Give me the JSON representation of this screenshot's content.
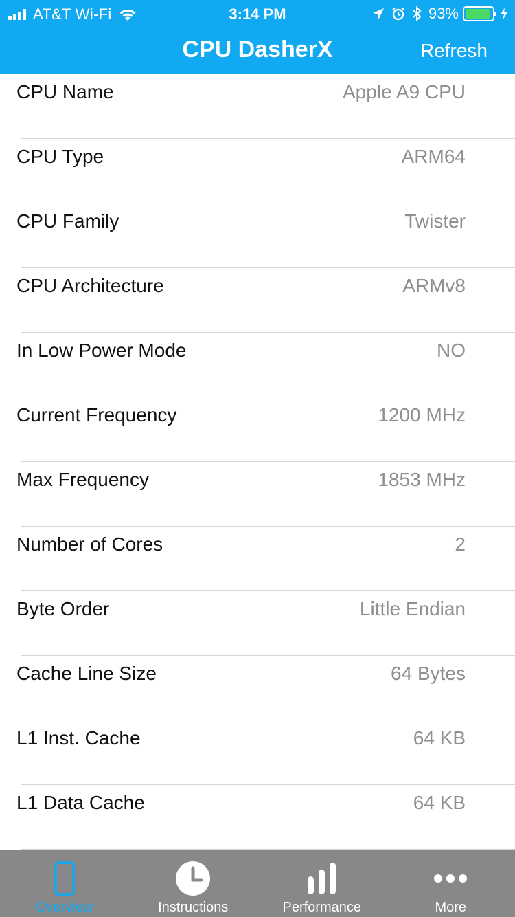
{
  "status_bar": {
    "carrier": "AT&T Wi-Fi",
    "time": "3:14 PM",
    "battery_percent": "93%",
    "battery_level": 0.93
  },
  "nav": {
    "title": "CPU DasherX",
    "refresh_label": "Refresh"
  },
  "rows": [
    {
      "label": "CPU Name",
      "value": "Apple A9 CPU"
    },
    {
      "label": "CPU Type",
      "value": "ARM64"
    },
    {
      "label": "CPU Family",
      "value": "Twister"
    },
    {
      "label": "CPU Architecture",
      "value": "ARMv8"
    },
    {
      "label": "In Low Power Mode",
      "value": "NO"
    },
    {
      "label": "Current Frequency",
      "value": "1200 MHz"
    },
    {
      "label": "Max Frequency",
      "value": "1853 MHz"
    },
    {
      "label": "Number of Cores",
      "value": "2"
    },
    {
      "label": "Byte Order",
      "value": "Little Endian"
    },
    {
      "label": "Cache Line Size",
      "value": "64 Bytes"
    },
    {
      "label": "L1 Inst. Cache",
      "value": "64 KB"
    },
    {
      "label": "L1 Data Cache",
      "value": "64 KB"
    }
  ],
  "tabs": [
    {
      "label": "Overview",
      "icon": "phone-icon",
      "active": true
    },
    {
      "label": "Instructions",
      "icon": "clock-icon",
      "active": false
    },
    {
      "label": "Performance",
      "icon": "bar-chart-icon",
      "active": false
    },
    {
      "label": "More",
      "icon": "more-dots-icon",
      "active": false
    }
  ],
  "colors": {
    "accent": "#11A9F2",
    "tabbar_bg": "#888888",
    "value_text": "#8e8e93",
    "battery": "#4CD964"
  }
}
